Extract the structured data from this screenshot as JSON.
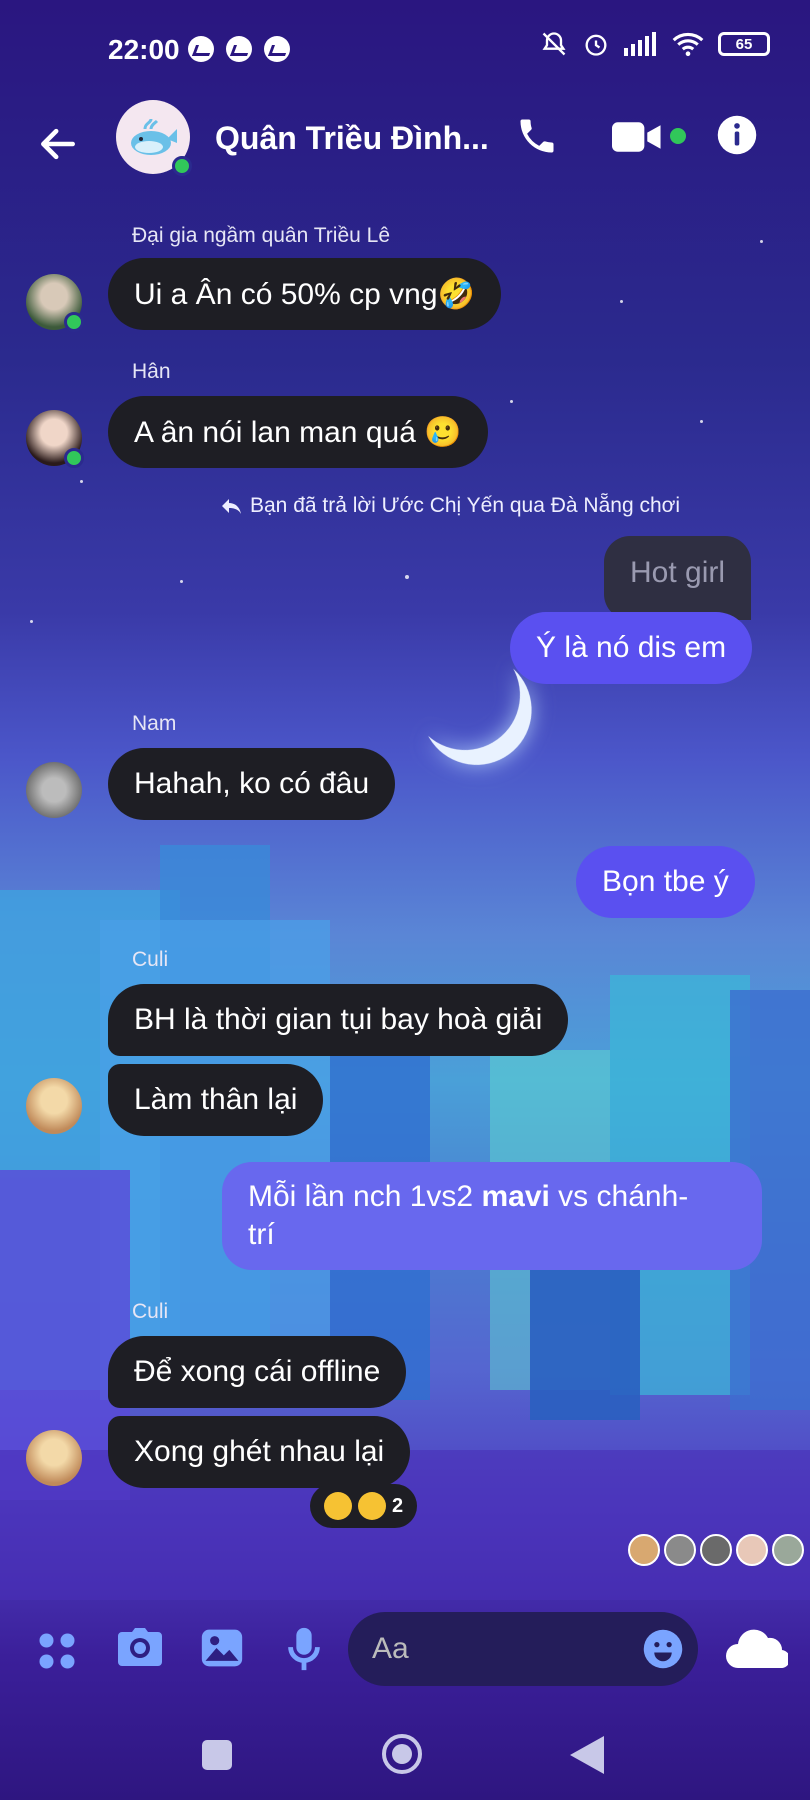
{
  "status_bar": {
    "time": "22:00",
    "battery": "65"
  },
  "header": {
    "title": "Quân Triều Đình...",
    "colors": {
      "online": "#31c75a"
    }
  },
  "messages": [
    {
      "sender": "Đại gia ngầm quân Triều Lê",
      "text": "Ui a Ân có 50% cp vng🤣",
      "direction": "in"
    },
    {
      "sender": "Hân",
      "text": "A ân nói lan man quá 🥲",
      "direction": "in"
    },
    {
      "reply_note": "Bạn đã trả lời Ước Chị Yến qua Đà Nẵng chơi",
      "quoted": "Hot girl",
      "text": "Ý là nó dis em",
      "direction": "out"
    },
    {
      "sender": "Nam",
      "text": "Hahah, ko có đâu",
      "direction": "in"
    },
    {
      "text": "Bọn tbe ý",
      "direction": "out"
    },
    {
      "sender": "Culi",
      "text": "BH là thời gian tụi bay hoà giải",
      "direction": "in"
    },
    {
      "text": "Làm thân lại",
      "direction": "in"
    },
    {
      "text_prefix": "Mỗi lần nch 1vs2 ",
      "text_bold": "mavi",
      "text_suffix": " vs chánh-",
      "text_line2": "trí",
      "direction": "out"
    },
    {
      "sender": "Culi",
      "text": "Để xong cái offline",
      "direction": "in"
    },
    {
      "text": "Xong ghét nhau lại",
      "direction": "in"
    }
  ],
  "reactions": {
    "count": "2"
  },
  "composer": {
    "placeholder": "Aa"
  },
  "icons": [
    "back-arrow-icon",
    "phone-icon",
    "video-icon",
    "info-icon",
    "menu-dots-icon",
    "camera-icon",
    "gallery-icon",
    "mic-icon",
    "emoji-icon",
    "cloud-icon"
  ]
}
